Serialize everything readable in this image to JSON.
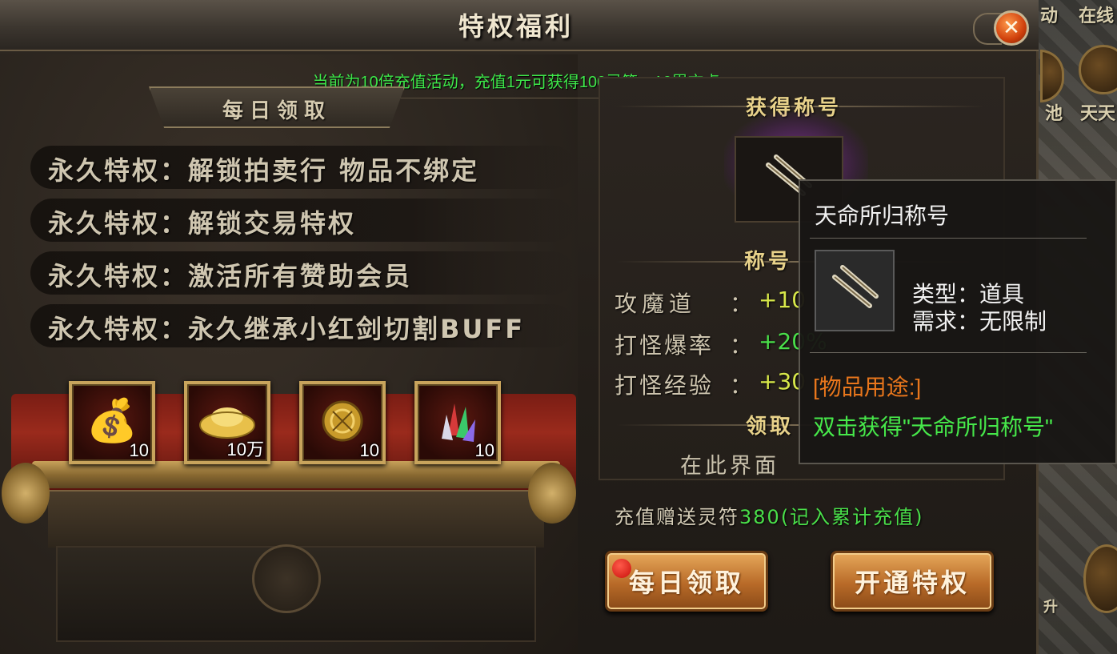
{
  "window": {
    "title": "特权福利",
    "close_icon": "close-icon"
  },
  "notice": "当前为10倍充值活动，充值1元可获得100灵符，10累充点",
  "daily_banner": "每日领取",
  "privileges": [
    {
      "text": "永久特权：解锁拍卖行 物品不绑定"
    },
    {
      "text": "永久特权：解锁交易特权"
    },
    {
      "text": "永久特权：激活所有赞助会员"
    },
    {
      "text": "永久特权：永久继承小红剑切割BUFF"
    }
  ],
  "rewards": [
    {
      "icon": "money-bag-icon",
      "count": "10"
    },
    {
      "icon": "gold-ingot-icon",
      "count": "10万"
    },
    {
      "icon": "gold-orb-icon",
      "count": "10"
    },
    {
      "icon": "crystal-shards-icon",
      "count": "10"
    }
  ],
  "title_section": {
    "header": "获得称号",
    "icon": "title-scroll-icon",
    "attr_header": "称号",
    "stats": [
      {
        "label": "攻魔道",
        "colon": "：",
        "value": "+10"
      },
      {
        "label": "打怪爆率",
        "colon": "：",
        "value": "+20%"
      },
      {
        "label": "打怪经验",
        "colon": "：",
        "value": "+30"
      }
    ],
    "claim_header": "领取",
    "here_text": "在此界面"
  },
  "bonus": {
    "prefix": "充值赠送灵符",
    "amount": "380",
    "suffix": "(记入累计充值)"
  },
  "buttons": {
    "daily_claim": "每日领取",
    "activate": "开通特权"
  },
  "tooltip": {
    "title": "天命所归称号",
    "icon": "title-scroll-icon",
    "type_line": "类型：道具",
    "require_line": "需求：无限制",
    "usage_header": "[物品用途:]",
    "usage_text": "双击获得\"天命所归称号\""
  },
  "backdrop": {
    "labels": [
      "动",
      "在线",
      "池",
      "天天",
      "升"
    ]
  },
  "colors": {
    "notice_green": "#3ee84a",
    "stat_yellow": "#d8e84a",
    "accent_gold": "#e8d28a",
    "tooltip_orange": "#e8761c"
  }
}
